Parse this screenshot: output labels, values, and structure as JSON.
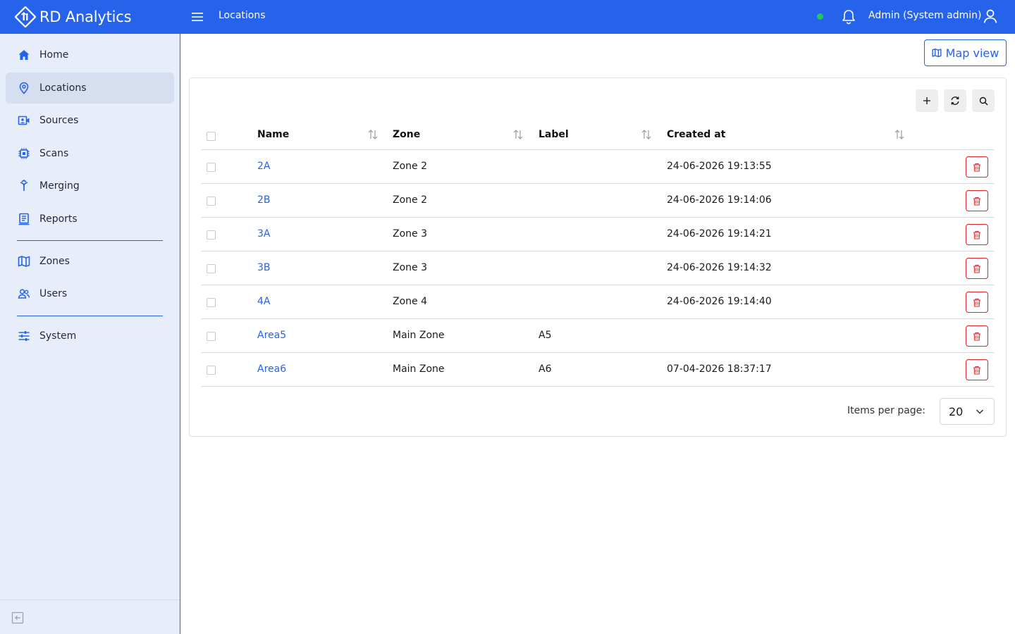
{
  "app": {
    "name": "RD Analytics"
  },
  "header": {
    "page_title": "Locations",
    "user": "Admin (System admin)"
  },
  "colors": {
    "primary": "#2563eb",
    "status_online": "#22c55e",
    "danger": "#dc2626"
  },
  "sidebar": {
    "items": [
      {
        "label": "Home",
        "icon": "home-icon"
      },
      {
        "label": "Locations",
        "icon": "map-pin-icon",
        "active": true
      },
      {
        "label": "Sources",
        "icon": "camera-icon"
      },
      {
        "label": "Scans",
        "icon": "chip-icon"
      },
      {
        "label": "Merging",
        "icon": "merge-icon"
      },
      {
        "label": "Reports",
        "icon": "report-icon"
      },
      {
        "label": "Zones",
        "icon": "map-icon"
      },
      {
        "label": "Users",
        "icon": "users-icon"
      },
      {
        "label": "System",
        "icon": "sliders-icon"
      }
    ]
  },
  "toolbar": {
    "map_view_label": "Map view"
  },
  "table": {
    "columns": {
      "name": "Name",
      "zone": "Zone",
      "label": "Label",
      "created_at": "Created at"
    },
    "rows": [
      {
        "name": "2A",
        "zone": "Zone 2",
        "label": "",
        "created_at": "24-06-2026 19:13:55"
      },
      {
        "name": "2B",
        "zone": "Zone 2",
        "label": "",
        "created_at": "24-06-2026 19:14:06"
      },
      {
        "name": "3A",
        "zone": "Zone 3",
        "label": "",
        "created_at": "24-06-2026 19:14:21"
      },
      {
        "name": "3B",
        "zone": "Zone 3",
        "label": "",
        "created_at": "24-06-2026 19:14:32"
      },
      {
        "name": "4A",
        "zone": "Zone 4",
        "label": "",
        "created_at": "24-06-2026 19:14:40"
      },
      {
        "name": "Area5",
        "zone": "Main Zone",
        "label": "A5",
        "created_at": ""
      },
      {
        "name": "Area6",
        "zone": "Main Zone",
        "label": "A6",
        "created_at": "07-04-2026 18:37:17"
      }
    ]
  },
  "pagination": {
    "items_per_page_label": "Items per page:",
    "items_per_page": "20"
  }
}
